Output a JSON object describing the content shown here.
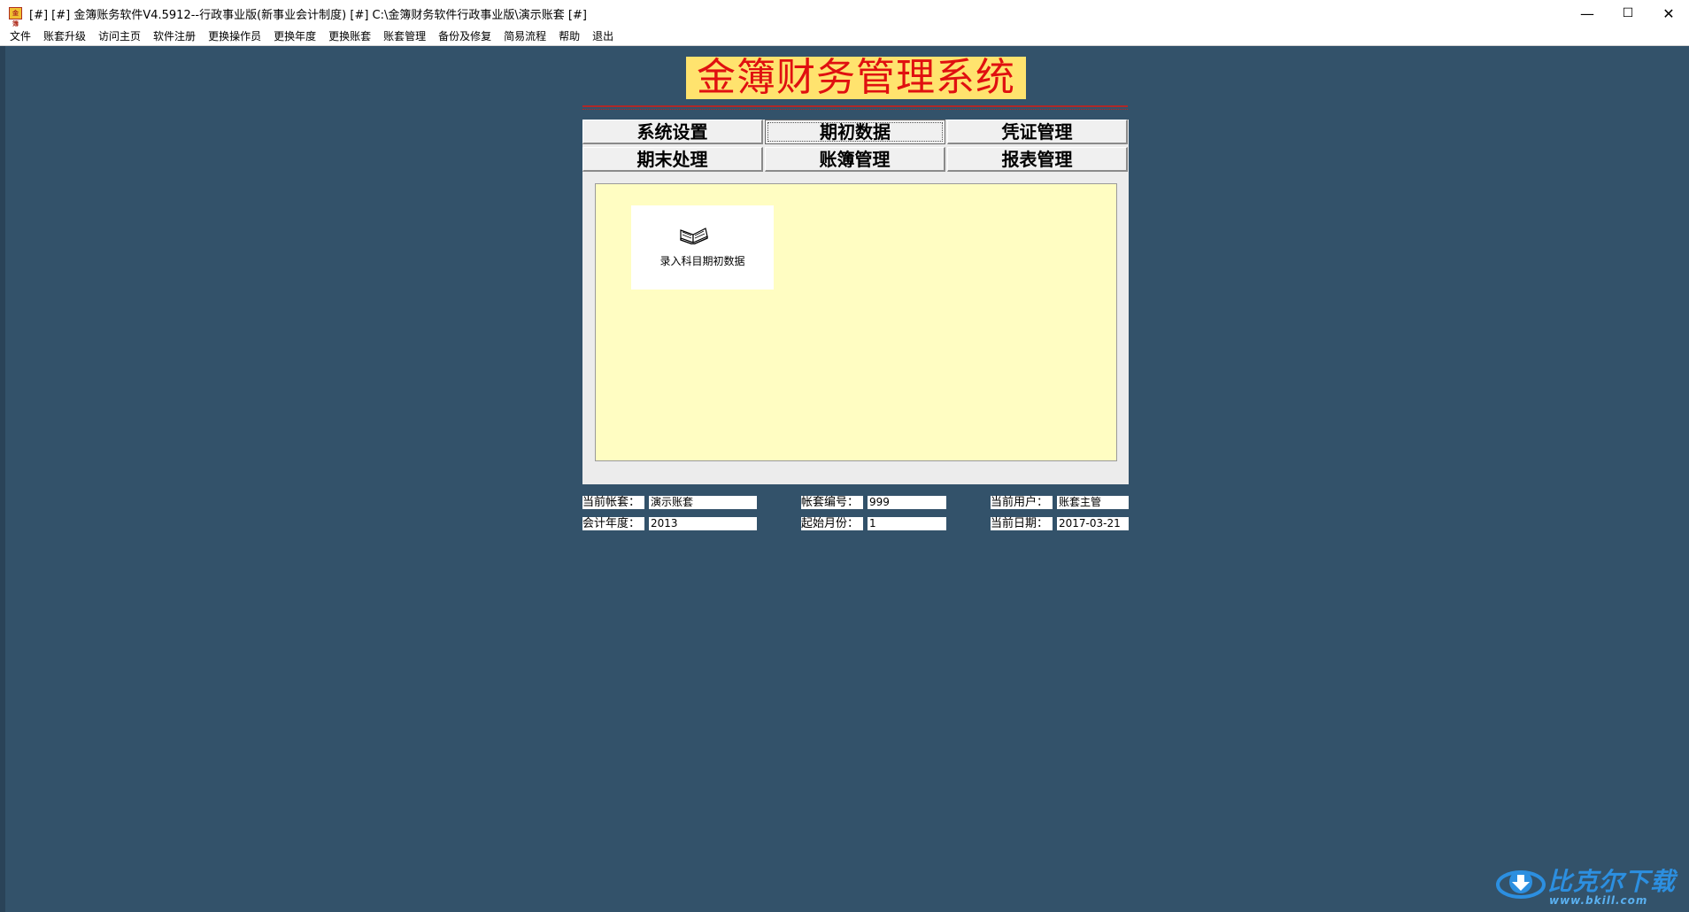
{
  "window": {
    "app_icon_text": "金簿",
    "title": "[#] [#] 金簿账务软件V4.5912--行政事业版(新事业会计制度) [#]    C:\\金簿财务软件行政事业版\\演示账套 [#]",
    "controls": {
      "minimize": "—",
      "maximize": "☐",
      "close": "✕"
    }
  },
  "menu": [
    "文件",
    "账套升级",
    "访问主页",
    "软件注册",
    "更换操作员",
    "更换年度",
    "更换账套",
    "账套管理",
    "备份及修复",
    "简易流程",
    "帮助",
    "退出"
  ],
  "banner": {
    "title": "金簿财务管理系统"
  },
  "nav": {
    "row1": [
      "系统设置",
      "期初数据",
      "凭证管理"
    ],
    "row2": [
      "期末处理",
      "账簿管理",
      "报表管理"
    ],
    "active": "期初数据"
  },
  "content": {
    "tiles": [
      {
        "label": "录入科目期初数据",
        "icon": "open-book-icon"
      }
    ]
  },
  "info": {
    "current_book_label": "当前帐套：",
    "current_book_value": "演示账套",
    "book_no_label": "帐套编号：",
    "book_no_value": "999",
    "current_user_label": "当前用户：",
    "current_user_value": "账套主管",
    "fiscal_year_label": "会计年度：",
    "fiscal_year_value": "2013",
    "start_month_label": "起始月份：",
    "start_month_value": "1",
    "current_date_label": "当前日期：",
    "current_date_value": "2017-03-21"
  },
  "watermark": {
    "brand": "比克尔下载",
    "url": "www.bkill.com"
  },
  "colors": {
    "desktop_bg": "#33526a",
    "banner_bg": "#ffe36e",
    "banner_text": "#e01010",
    "content_bg": "#fffdc2"
  }
}
